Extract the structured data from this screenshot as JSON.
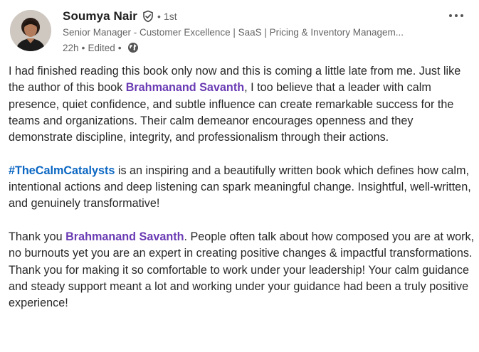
{
  "author": {
    "name": "Soumya Nair",
    "connection_degree": "1st",
    "headline": "Senior Manager - Customer Excellence | SaaS | Pricing & Inventory Managem...",
    "time": "22h",
    "edited": "Edited",
    "avatar_icon": "profile-photo"
  },
  "icons": {
    "verified": "verified-shield-icon",
    "visibility": "globe-icon",
    "menu": "more-options-icon"
  },
  "colors": {
    "mention": "#6a3bb3",
    "hashtag": "#0a66c2",
    "muted": "#666666"
  },
  "post": {
    "p1": {
      "before": "I had finished reading this book only now and this is coming a little late from me. Just like the author of this book ",
      "mention": "Brahmanand Savanth",
      "after": ", I too believe that a leader with calm presence, quiet confidence, and subtle influence can create remarkable success for the teams and organizations. Their calm demeanor encourages openness and they demonstrate discipline, integrity, and professionalism through their actions."
    },
    "p2": {
      "hashtag": "#TheCalmCatalysts",
      "after": " is an inspiring and a beautifully written book which defines how calm, intentional actions and deep listening can spark meaningful change. Insightful, well-written, and genuinely transformative!"
    },
    "p3": {
      "before": "Thank you ",
      "mention": "Brahmanand Savanth",
      "after": ". People often talk about how composed you are at work, no burnouts yet you are an expert in creating positive changes & impactful transformations. Thank you for making it so comfortable to work under your leadership! Your calm guidance and steady support meant a lot and working under your guidance had been a truly positive experience!"
    }
  }
}
